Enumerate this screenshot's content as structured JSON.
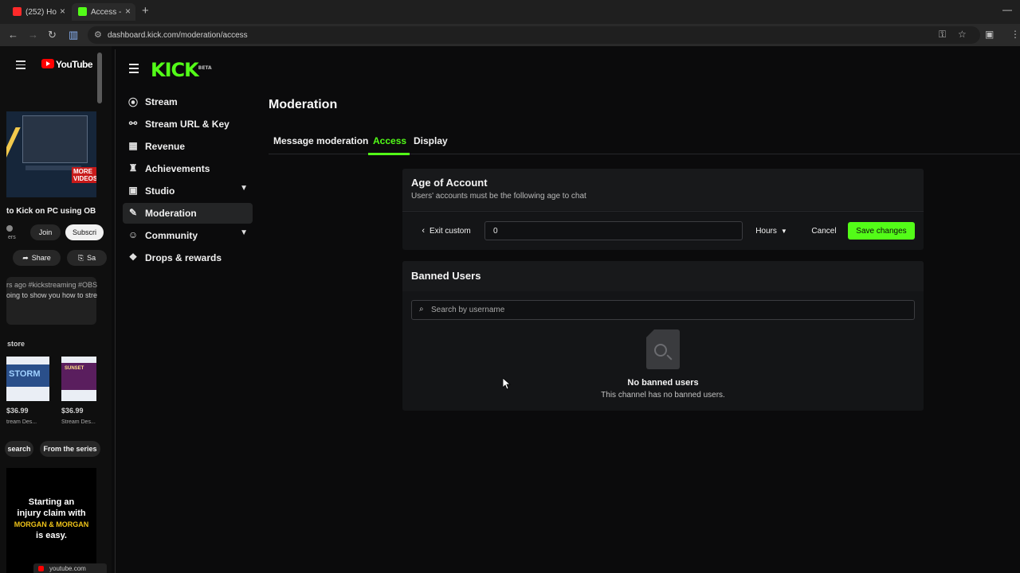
{
  "browser": {
    "tabs": [
      {
        "title": "(252) Ho",
        "favicon_color": "#ff2a2a"
      },
      {
        "title": "Access -",
        "favicon_color": "#53fc18"
      }
    ],
    "url": "dashboard.kick.com/moderation/access"
  },
  "youtube_panel": {
    "logo": "YouTube",
    "video_title": "to Kick on PC using OB",
    "join_label": "Join",
    "subscribe_label": "Subscri",
    "share_label": "Share",
    "save_label": "Sa",
    "meta_line": "rs ago  #kickstreaming #OBS",
    "desc_line": "oing to show you how to stre",
    "more_videos": "MORE VIDEOS",
    "store_label": "store",
    "products": [
      {
        "price": "$36.99",
        "name": "tream Des...",
        "thumb": "STORM"
      },
      {
        "price": "$36.99",
        "name": "Stream Des...",
        "thumb": "SUNSET"
      }
    ],
    "search_chip": "search",
    "series_chip": "From the series",
    "ad_lines": [
      "Starting an",
      "injury claim with",
      "MORGAN & MORGAN",
      "is easy."
    ],
    "ad_domain": "youtube.com"
  },
  "kick": {
    "logo": "KICK",
    "logo_badge": "BETA",
    "nav": [
      {
        "label": "Stream",
        "icon": "broadcast-icon"
      },
      {
        "label": "Stream URL & Key",
        "icon": "link-icon"
      },
      {
        "label": "Revenue",
        "icon": "chart-icon"
      },
      {
        "label": "Achievements",
        "icon": "trophy-icon"
      },
      {
        "label": "Studio",
        "icon": "studio-icon"
      },
      {
        "label": "Moderation",
        "icon": "wrench-icon"
      },
      {
        "label": "Community",
        "icon": "community-icon"
      },
      {
        "label": "Drops & rewards",
        "icon": "gift-icon"
      }
    ],
    "page_title": "Moderation",
    "tabs": [
      "Message moderation",
      "Access",
      "Display"
    ],
    "active_tab": "Access",
    "accent": "#53fc18",
    "age": {
      "title": "Age of Account",
      "subtitle": "Users' accounts must be the following age to chat",
      "exit_custom": "Exit custom",
      "value": "0",
      "unit": "Hours",
      "cancel": "Cancel",
      "save": "Save changes"
    },
    "banned": {
      "title": "Banned Users",
      "search_placeholder": "Search by username",
      "empty_title": "No banned users",
      "empty_sub": "This channel has no banned users."
    }
  }
}
